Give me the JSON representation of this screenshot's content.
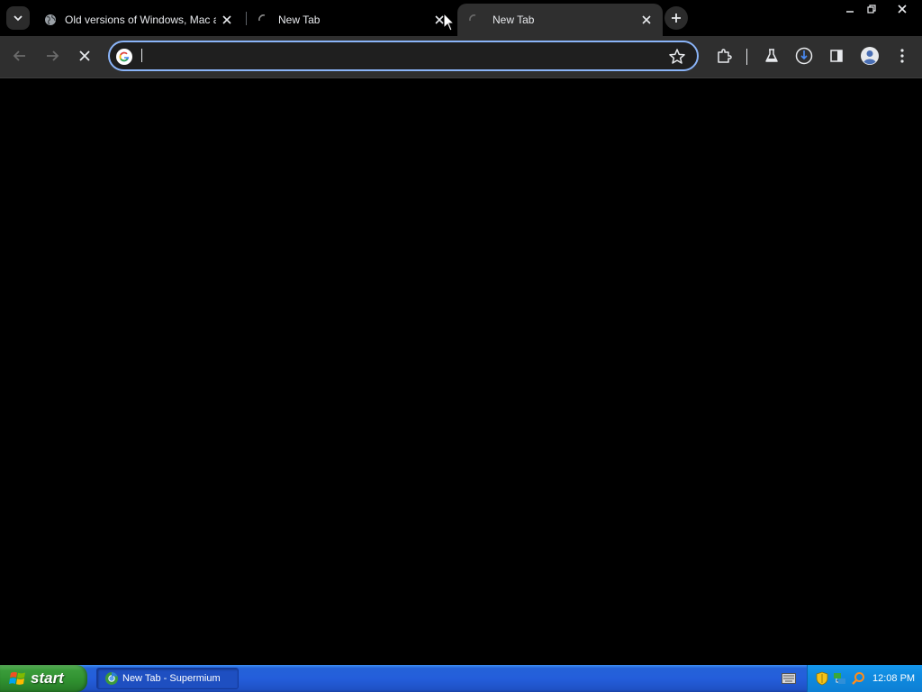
{
  "browser": {
    "tabs": [
      {
        "title": "Old versions of Windows, Mac and",
        "favicon": "globe-icon",
        "active": false
      },
      {
        "title": "New Tab",
        "favicon": "loading-spinner-icon",
        "active": false
      },
      {
        "title": "New Tab",
        "favicon": "loading-spinner-icon",
        "active": true
      }
    ],
    "omnibox": {
      "value": "",
      "placeholder": ""
    }
  },
  "colors": {
    "tabstrip_bg": "#000000",
    "active_tab_bg": "#2f2f2f",
    "toolbar_bg": "#2f2f2f",
    "omnibox_focus_border": "#8ab4f8",
    "content_bg": "#000000",
    "taskbar_blue": "#245edb",
    "start_green": "#3a9c3a",
    "tray_blue": "#0f8be0"
  },
  "taskbar": {
    "start_label": "start",
    "tasks": [
      {
        "label": "New Tab - Supermium",
        "icon": "supermium-icon"
      }
    ],
    "clock": "12:08 PM"
  }
}
